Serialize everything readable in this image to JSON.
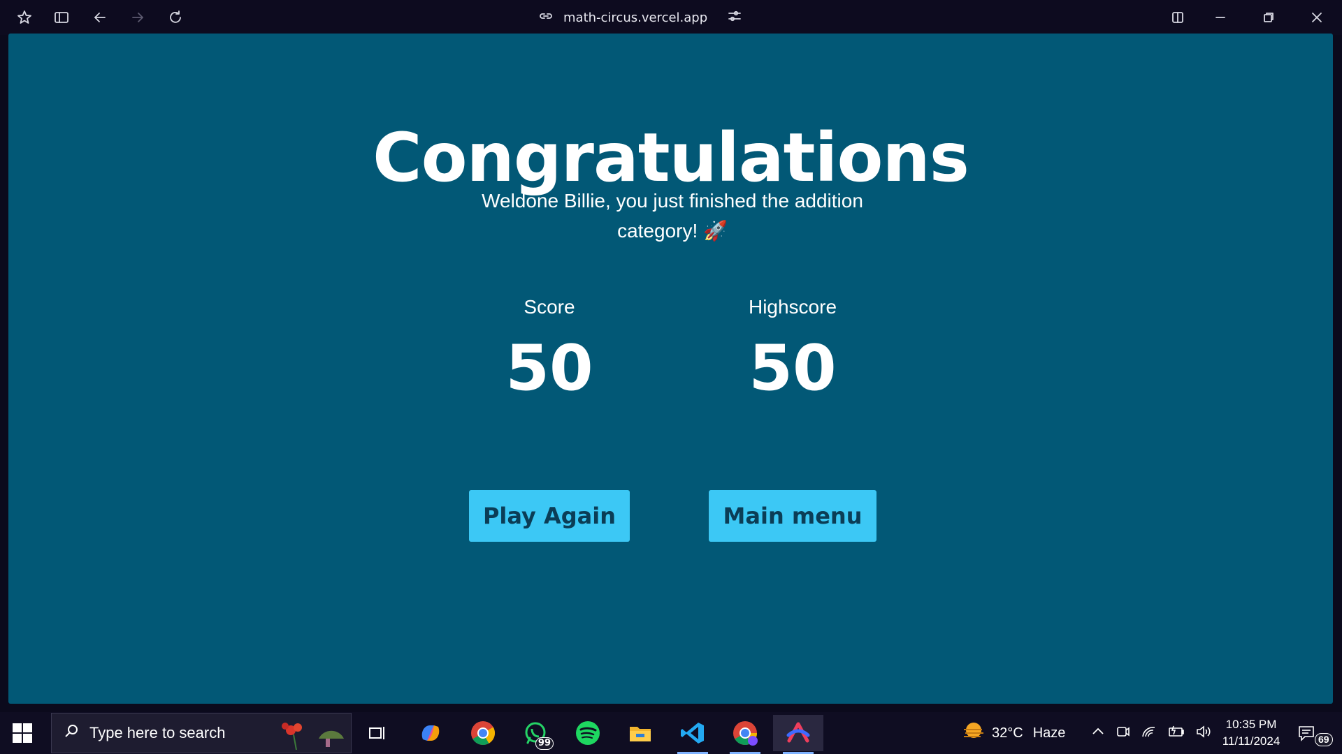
{
  "browser": {
    "url": "math-circus.vercel.app"
  },
  "game": {
    "title": "Congratulations",
    "message": "Weldone Billie, you just finished the addition category! 🚀",
    "score_label": "Score",
    "score_value": "50",
    "highscore_label": "Highscore",
    "highscore_value": "50",
    "play_again_label": "Play Again",
    "main_menu_label": "Main menu"
  },
  "taskbar": {
    "search_placeholder": "Type here to search",
    "whatsapp_badge": "99",
    "weather_temp": "32°C",
    "weather_desc": "Haze",
    "time": "10:35 PM",
    "date": "11/11/2024",
    "notifications_count": "69"
  },
  "colors": {
    "page_background": "#025876",
    "button_background": "#3cc8f5",
    "button_text": "#0b3d56",
    "chrome_background": "#0d0b1f"
  }
}
